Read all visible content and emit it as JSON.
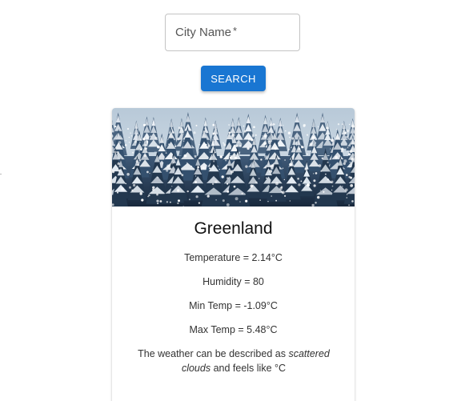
{
  "search": {
    "placeholder": "City Name",
    "required_marker": "*",
    "button_label": "SEARCH"
  },
  "card": {
    "image_alt": "snowy forest",
    "title": "Greenland",
    "temperature": "Temperature = 2.14°C",
    "humidity": "Humidity = 80",
    "min_temp": "Min Temp = -1.09°C",
    "max_temp": "Max Temp = 5.48°C",
    "description": {
      "prefix": "The weather can be described as ",
      "condition": "scattered clouds",
      "suffix": " and feels like °C"
    }
  },
  "colors": {
    "accent": "#1976d2"
  }
}
